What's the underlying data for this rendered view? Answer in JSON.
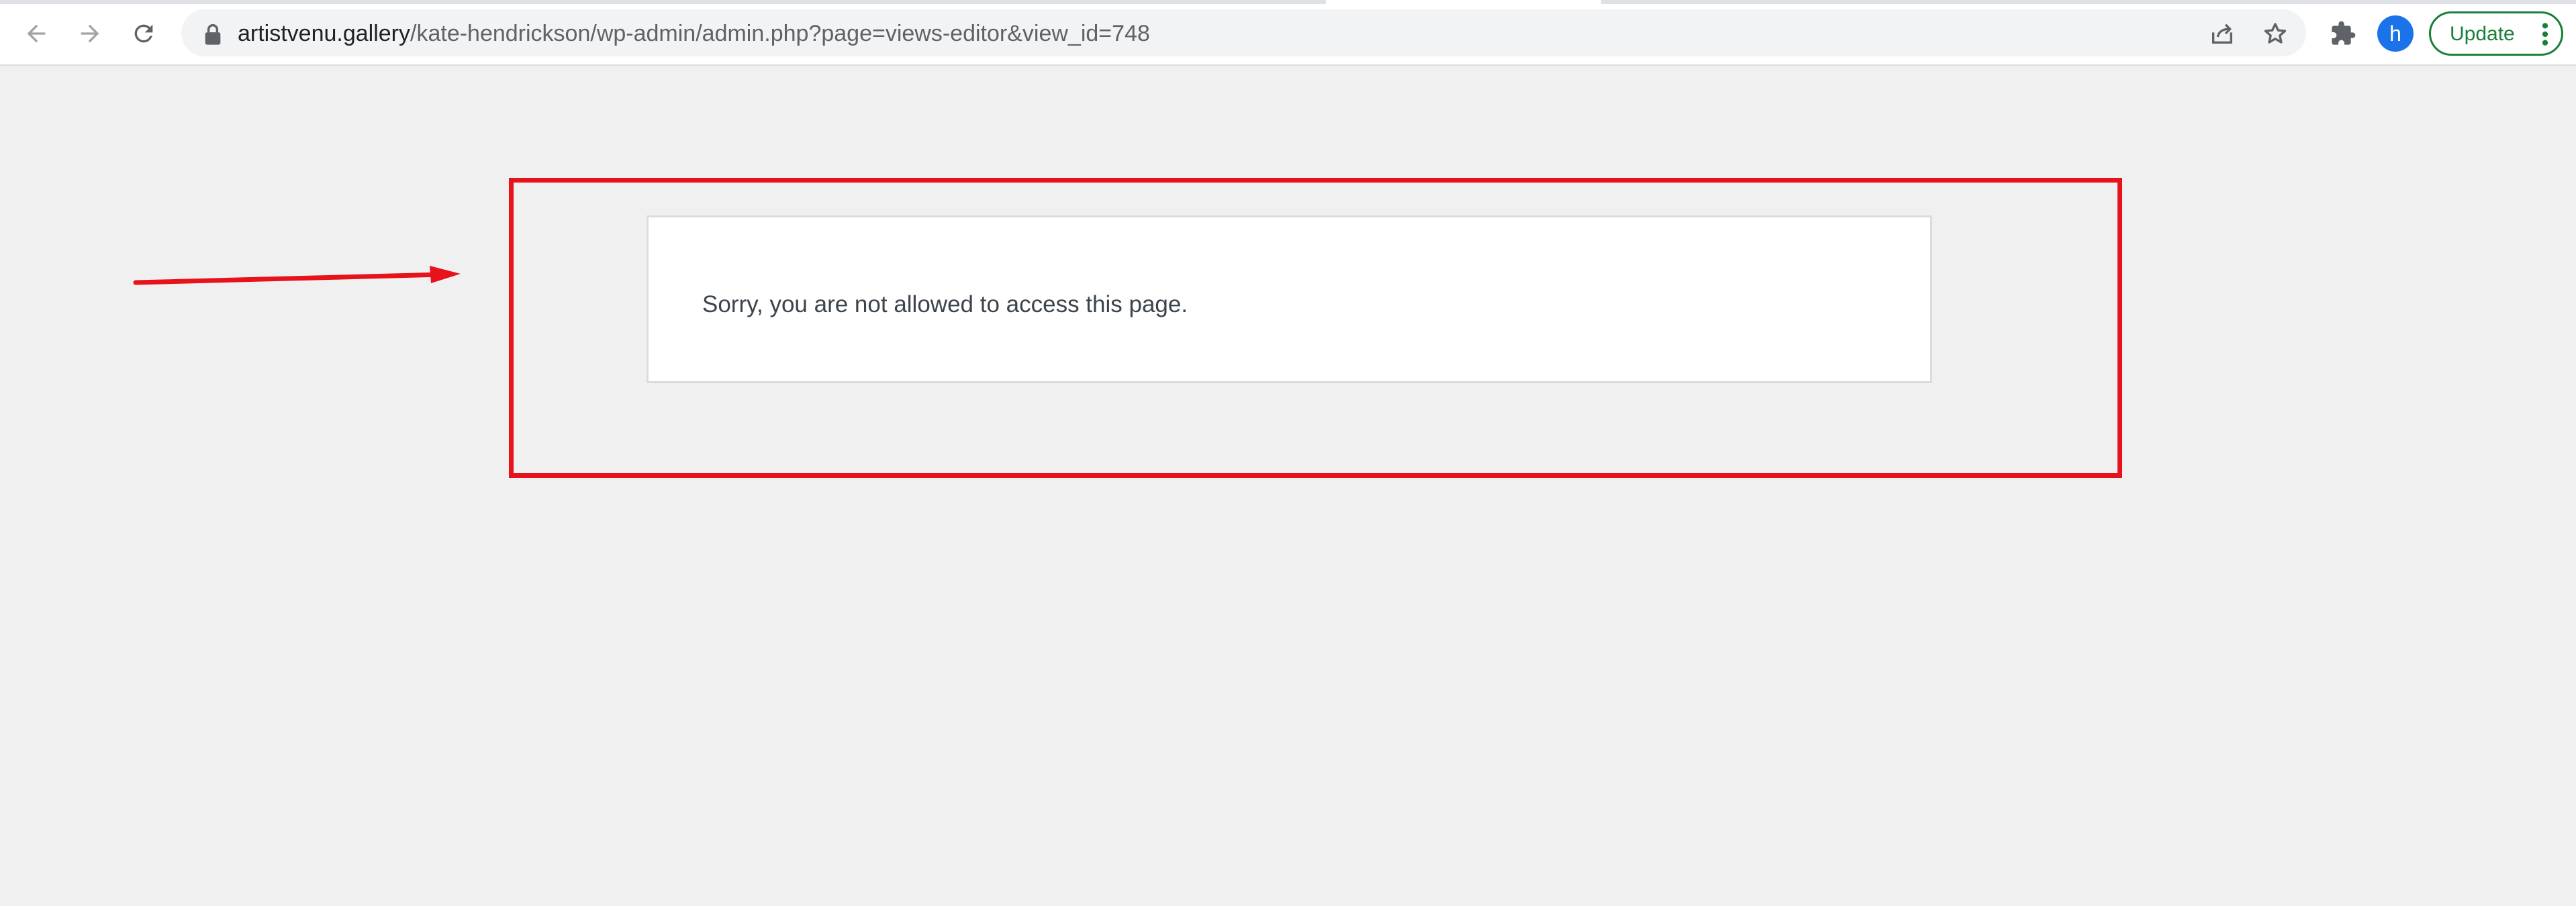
{
  "browser": {
    "address_bar": {
      "host": "artistvenu.gallery",
      "path": "/kate-hendrickson/wp-admin/admin.php?page=views-editor&view_id=748"
    },
    "profile_initial": "h",
    "update_label": "Update",
    "icons": {
      "back": "arrow-left-icon",
      "forward": "arrow-right-icon",
      "reload": "reload-icon",
      "lock": "lock-icon",
      "share": "share-icon",
      "bookmark": "star-icon",
      "extensions": "puzzle-icon",
      "menu": "kebab-menu-icon"
    },
    "colors": {
      "update_accent": "#188038",
      "avatar_bg": "#1a73e8"
    }
  },
  "page": {
    "message": "Sorry, you are not allowed to access this page."
  },
  "annotation": {
    "color": "#e8121a"
  }
}
